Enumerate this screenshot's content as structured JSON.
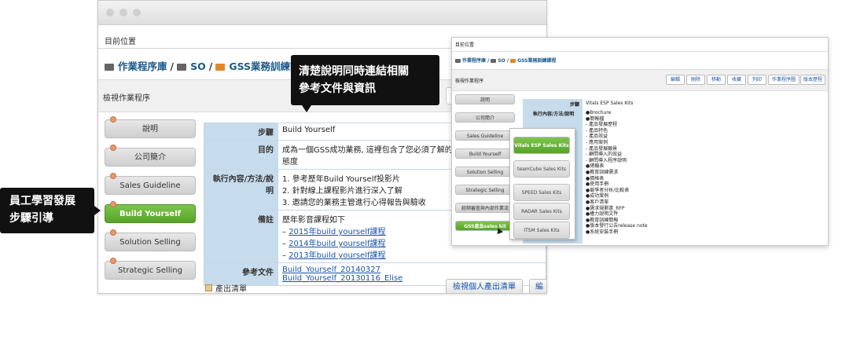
{
  "main": {
    "location_label": "目前位置",
    "breadcrumb": [
      "作業程序庫",
      "SO",
      "GSS業務訓練課程"
    ],
    "panel_title": "檢視作業程序",
    "sidebar": [
      {
        "label": "說明",
        "active": false
      },
      {
        "label": "公司簡介",
        "active": false
      },
      {
        "label": "Sales Guideline",
        "active": false
      },
      {
        "label": "Build Yourself",
        "active": true
      },
      {
        "label": "Solution Selling",
        "active": false
      },
      {
        "label": "Strategic Selling",
        "active": false
      }
    ],
    "table": {
      "step_label": "步驟",
      "step_value": "Build Yourself",
      "goal_label": "目的",
      "goal_value": "成為一個GSS成功業務, 這裡包含了您必須了解的基本",
      "goal_value_2": "態度",
      "method_label": "執行內容/方法/說明",
      "method_items": [
        "1. 參考歷年Build Yourself投影片",
        "2. 針對線上課程影片進行深入了解",
        "3. 邀請您的業務主管進行心得報告與驗收"
      ],
      "remark_label": "備註",
      "remark_intro": "歷年影音課程如下",
      "remark_links": [
        "2015年build yourself課程",
        "2014年build yourself課程",
        "2013年build yourself課程"
      ],
      "ref_label": "參考文件",
      "ref_links": [
        "Build_Yourself_20140327",
        "Build_Yourself_20130116_Elise"
      ]
    },
    "output_label": "產出清單",
    "output_button": "檢視個人產出清單",
    "output_button_2": "編"
  },
  "callouts": {
    "top": [
      "清楚說明同時連結相關",
      "參考文件與資訊"
    ],
    "left": [
      "員工學習發展",
      "步驟引導"
    ]
  },
  "secondary": {
    "location_label": "目前位置",
    "breadcrumb": [
      "作業程序庫",
      "SO",
      "GSS業務訓練課程"
    ],
    "panel_title": "檢視作業程序",
    "buttons": [
      "編輯",
      "刪除",
      "移動",
      "收藏",
      "列印",
      "作業程序圖",
      "版本歷程"
    ],
    "sidebar": [
      {
        "label": "說明",
        "active": false
      },
      {
        "label": "公司簡介",
        "active": false
      },
      {
        "label": "Sales Guideline",
        "active": false
      },
      {
        "label": "Build Yourself",
        "active": false
      },
      {
        "label": "Solution Selling",
        "active": false
      },
      {
        "label": "Strategic Selling",
        "active": false
      },
      {
        "label": "經銷審查與內部作業流",
        "active": false
      },
      {
        "label": "GSS產品sales kit",
        "active": true
      }
    ],
    "popup": [
      {
        "label": "Vitals ESP Sales Kits",
        "active": true
      },
      {
        "label": "teamCube Sales Kits",
        "active": false
      },
      {
        "label": "SPEED Sales Kits",
        "active": false
      },
      {
        "label": "RADAR Sales Kits",
        "active": false
      },
      {
        "label": "ITSM Sales Kits",
        "active": false
      }
    ],
    "step_label": "步驟",
    "step_value": "Vitals ESP Sales Kits",
    "method_label": "執行內容/方法/說明",
    "method_list": [
      "●Brochure",
      "●簡報檔",
      "  - 產品發展歷程",
      "  - 產品特色",
      "  - 產品效益",
      "  - 應用案例",
      "  - 產品發展願景",
      "  - 顧問導入的效益",
      "  - 顧問導入程序說明",
      "●總機表",
      "●教育訓練需求",
      "●價格表",
      "●使用手冊",
      "●競爭者分析/比較表",
      "●成功案例",
      "●客戶清單",
      "●需求規劃書_RFP",
      "●權力說明文件",
      "●教育訓練簡報",
      "●版本發行公告release note",
      "●系統安裝手冊"
    ]
  }
}
